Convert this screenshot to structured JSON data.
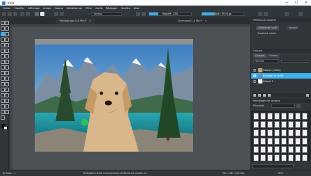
{
  "window": {
    "title": "Krita",
    "minimize": "—",
    "maximize": "☐",
    "close": "✕"
  },
  "menu": [
    "Fichier",
    "Modifier",
    "Affichage",
    "Image",
    "Calque",
    "Sélectionner",
    "Filtre",
    "Outils",
    "Réglages",
    "Fenêtre",
    "Aide"
  ],
  "toolbar": {
    "blend_mode": "Normal",
    "opacity_label": "Opacité : 22%",
    "opacity_value": 22,
    "size_label": "Taille : 30,01 px",
    "size_value": 30
  },
  "tabs": [
    {
      "label": "Paysage.jpg (1,0 Mo) *",
      "active": true
    },
    {
      "label": "Chien.png (1,3 Mo) *",
      "active": false
    }
  ],
  "docker": {
    "header": "Préférences d'outils",
    "subtabs": [
      "Options de l'outil",
      "Avancé"
    ],
    "assistant": "Assistant actuel",
    "layers_header": "Calques",
    "layer_tabs": [
      "Calques",
      "Canaux"
    ],
    "blend": "Normal",
    "layers": [
      {
        "name": "Calque ( Chien)",
        "selected": false
      },
      {
        "name": "Paysage de lumiè...",
        "selected": true
      },
      {
        "name": "Calque 1",
        "selected": false
      }
    ],
    "brush_header": "Préréglages de brosses",
    "brush_filter": "Étiquette",
    "search_placeholder": "Rechercher"
  },
  "status": {
    "brush": "b) Basic - 1",
    "color": "RGB/Alpha (8 bit entiers/canal) sRGB-elle-V2-srgbtrc.icc",
    "size": "700 x 467 (1,8 Mio)",
    "zoom": "38%"
  }
}
